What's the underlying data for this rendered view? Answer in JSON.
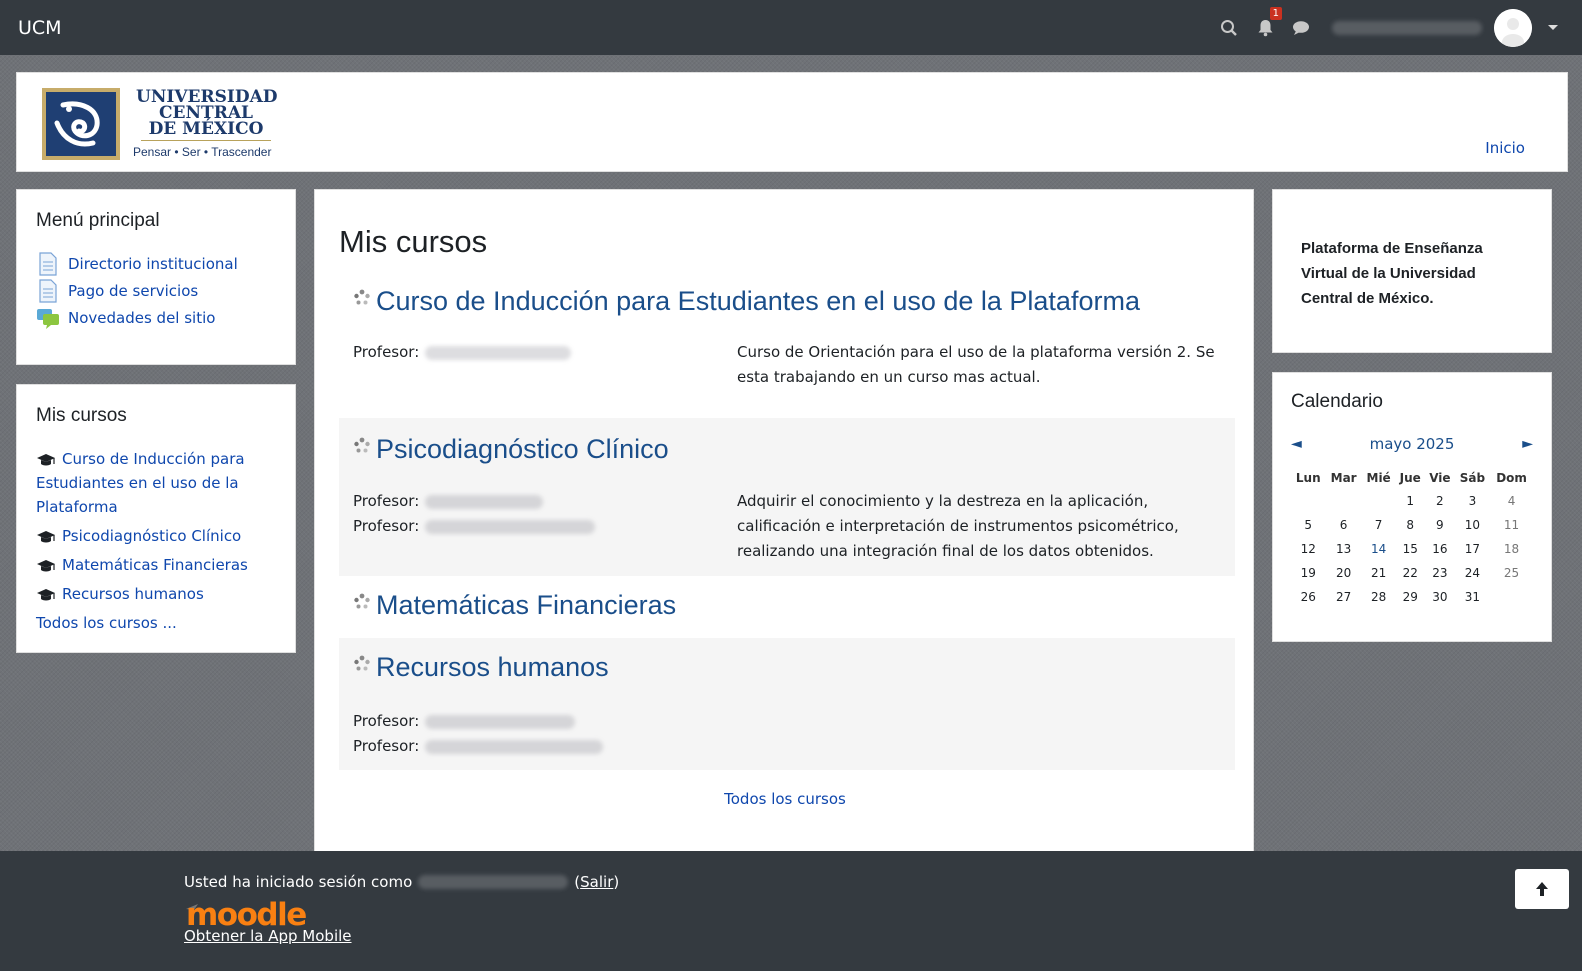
{
  "navbar": {
    "brand": "UCM",
    "notification_count": "1"
  },
  "header": {
    "logo_line1": "UNIVERSIDAD",
    "logo_line2": "CENTRAL",
    "logo_line3": "DE MÉXICO",
    "logo_slogan": "Pensar • Ser • Trascender",
    "home_link": "Inicio"
  },
  "left": {
    "main_menu": {
      "title": "Menú principal",
      "items": [
        {
          "label": "Directorio institucional",
          "icon": "page-icon"
        },
        {
          "label": "Pago de servicios",
          "icon": "page-icon"
        },
        {
          "label": "Novedades del sitio",
          "icon": "forum-icon"
        }
      ]
    },
    "my_courses": {
      "title": "Mis cursos",
      "items": [
        "Curso de Inducción para Estudiantes en el uso de la Plataforma",
        "Psicodiagnóstico Clínico",
        "Matemáticas Financieras",
        "Recursos humanos"
      ],
      "all_link": "Todos los cursos ..."
    }
  },
  "main": {
    "title": "Mis cursos",
    "teacher_label": "Profesor:",
    "courses": [
      {
        "name": "Curso de Inducción para Estudiantes en el uso de la Plataforma",
        "summary": "Curso de Orientación para el uso de la plataforma versión 2.  Se esta trabajando en un curso mas actual."
      },
      {
        "name": "Psicodiagnóstico Clínico",
        "summary": "Adquirir el conocimiento y la destreza en la aplicación, calificación e interpretación de instrumentos psicométrico, realizando una integración final de los datos obtenidos."
      },
      {
        "name": "Matemáticas Financieras",
        "summary": ""
      },
      {
        "name": "Recursos humanos",
        "summary": ""
      }
    ],
    "all_courses_link": "Todos los cursos"
  },
  "right": {
    "info_text": "Plataforma de Enseñanza Virtual de la Universidad Central de México.",
    "calendar": {
      "title": "Calendario",
      "month": "mayo 2025",
      "prev": "◄",
      "next": "►",
      "weekdays": [
        "Lun",
        "Mar",
        "Mié",
        "Jue",
        "Vie",
        "Sáb",
        "Dom"
      ],
      "weeks": [
        [
          "",
          "",
          "",
          "1",
          "2",
          "3",
          "4"
        ],
        [
          "5",
          "6",
          "7",
          "8",
          "9",
          "10",
          "11"
        ],
        [
          "12",
          "13",
          "14",
          "15",
          "16",
          "17",
          "18"
        ],
        [
          "19",
          "20",
          "21",
          "22",
          "23",
          "24",
          "25"
        ],
        [
          "26",
          "27",
          "28",
          "29",
          "30",
          "31",
          ""
        ]
      ],
      "today": "14"
    }
  },
  "footer": {
    "logged_in_text": "Usted ha iniciado sesión como",
    "logout_link": "Salir",
    "logout_prefix": "(",
    "logout_suffix": ")",
    "moodle_logo_text": "moodle",
    "app_link": "Obtener la App Mobile"
  },
  "colors": {
    "navbar_bg": "#343a40",
    "link": "#0f47ad",
    "course_title": "#1a4e8a",
    "badge": "#ca3120",
    "moodle_orange": "#f98012"
  }
}
